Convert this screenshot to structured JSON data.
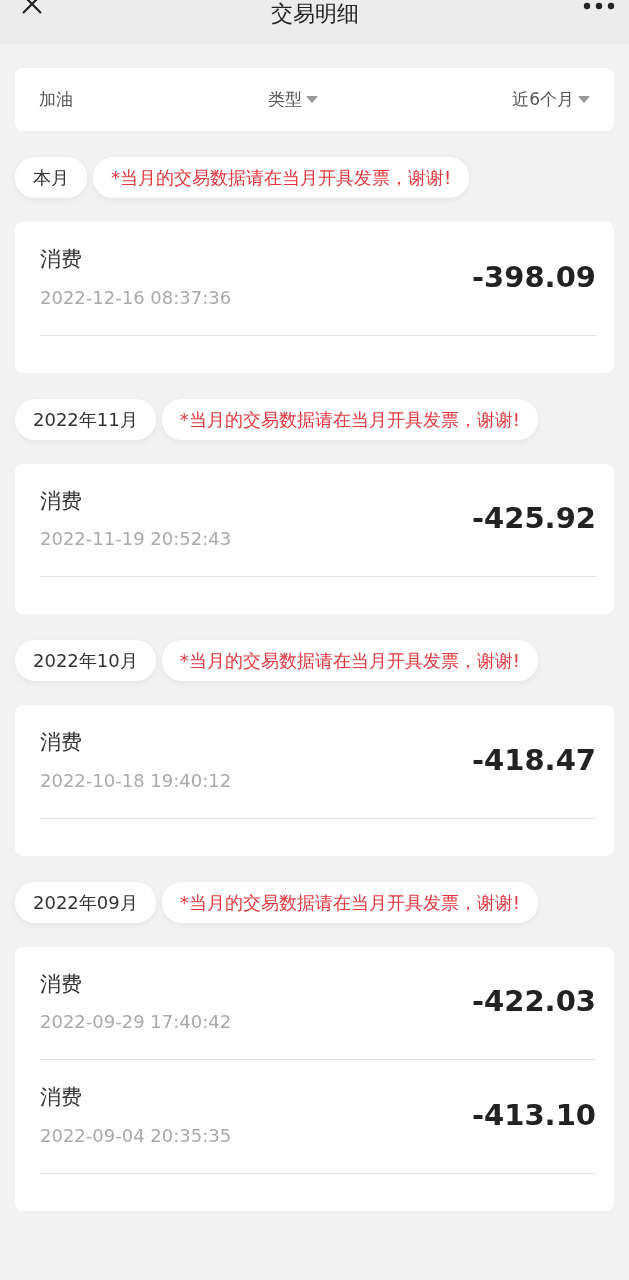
{
  "header": {
    "title": "交易明细"
  },
  "filters": [
    {
      "label": "加油",
      "dropdown": false
    },
    {
      "label": "类型",
      "dropdown": true
    },
    {
      "label": "近6个月",
      "dropdown": true
    }
  ],
  "groups": [
    {
      "month": "本月",
      "notice": "*当月的交易数据请在当月开具发票，谢谢!",
      "transactions": [
        {
          "type": "消费",
          "time": "2022-12-16 08:37:36",
          "amount": "-398.09"
        }
      ]
    },
    {
      "month": "2022年11月",
      "notice": "*当月的交易数据请在当月开具发票，谢谢!",
      "transactions": [
        {
          "type": "消费",
          "time": "2022-11-19 20:52:43",
          "amount": "-425.92"
        }
      ]
    },
    {
      "month": "2022年10月",
      "notice": "*当月的交易数据请在当月开具发票，谢谢!",
      "transactions": [
        {
          "type": "消费",
          "time": "2022-10-18 19:40:12",
          "amount": "-418.47"
        }
      ]
    },
    {
      "month": "2022年09月",
      "notice": "*当月的交易数据请在当月开具发票，谢谢!",
      "transactions": [
        {
          "type": "消费",
          "time": "2022-09-29 17:40:42",
          "amount": "-422.03"
        },
        {
          "type": "消费",
          "time": "2022-09-04 20:35:35",
          "amount": "-413.10"
        }
      ]
    }
  ]
}
